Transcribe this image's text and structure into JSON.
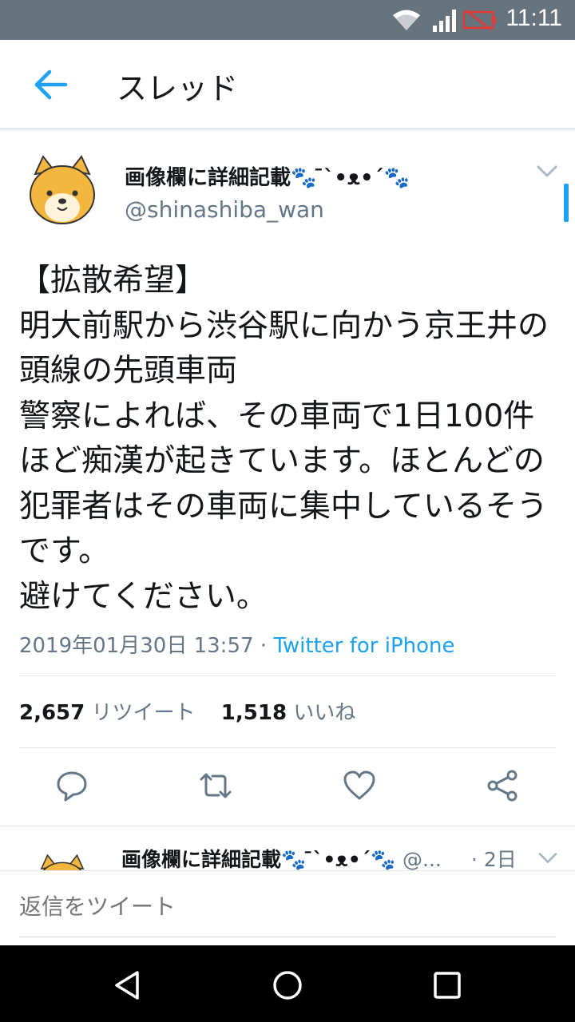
{
  "status_bar": {
    "time": "11:11"
  },
  "app_bar": {
    "title": "スレッド"
  },
  "tweet": {
    "display_name": "画像欄に詳細記載🐾 ̄`•ᴥ•´🐾",
    "handle": "@shinashiba_wan",
    "text": "【拡散希望】\n明大前駅から渋谷駅に向かう京王井の頭線の先頭車両\n警察によれば、その車両で1日100件ほど痴漢が起きています。ほとんどの犯罪者はその車両に集中しているそうです。\n避けてください。",
    "date": "2019年01月30日 13:57 · ",
    "source": "Twitter for iPhone",
    "retweet_count": "2,657",
    "retweet_label": "リツイート",
    "like_count": "1,518",
    "like_label": "いいね"
  },
  "next_tweet": {
    "display_name": "画像欄に詳細記載🐾 ̄`•ᴥ•´🐾",
    "handle": "@...",
    "time": "· 2日"
  },
  "reply_bar": {
    "placeholder": "返信をツイート"
  },
  "colors": {
    "accent": "#1da1f2",
    "status_bar": "#67737d",
    "secondary_text": "#657786"
  }
}
